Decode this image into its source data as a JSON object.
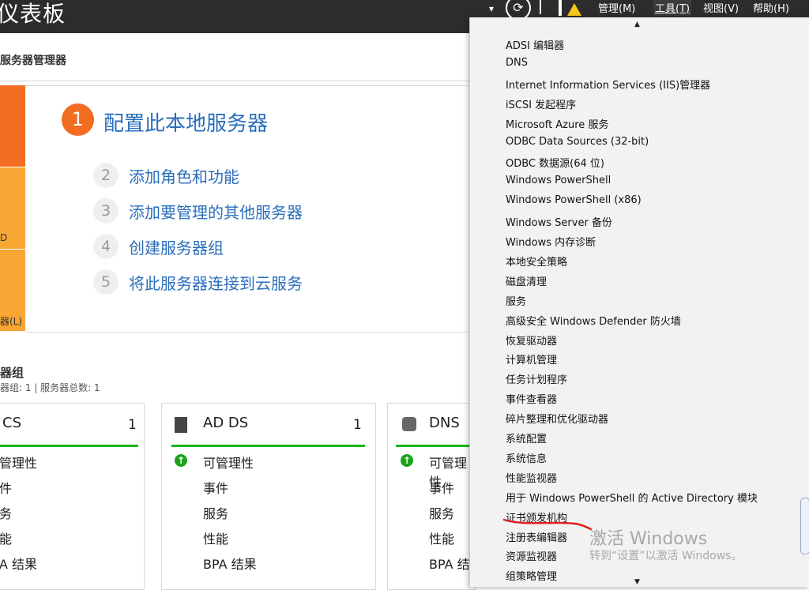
{
  "header": {
    "title": "仪表板",
    "menus": [
      {
        "label": "管理(M)"
      },
      {
        "label": "工具(T)"
      },
      {
        "label": "视图(V)"
      },
      {
        "label": "帮助(H)"
      }
    ],
    "dropdown_glyph": "▾",
    "refresh_glyph": "⟳"
  },
  "welcome": {
    "subtitle": "服务器管理器",
    "sidebar_text_1": "D",
    "sidebar_text_2": "器(L)",
    "main_step": {
      "num": "1",
      "label": "配置此本地服务器"
    },
    "steps": [
      {
        "num": "2",
        "label": "添加角色和功能"
      },
      {
        "num": "3",
        "label": "添加要管理的其他服务器"
      },
      {
        "num": "4",
        "label": "创建服务器组"
      },
      {
        "num": "5",
        "label": "将此服务器连接到云服务"
      }
    ]
  },
  "server_groups": {
    "title": "器组",
    "summary": "器组: 1 | 服务器总数: 1",
    "cards": [
      {
        "name": "CS",
        "count": "1",
        "rows": [
          "管理性",
          "件",
          "务",
          "能",
          "A 结果"
        ]
      },
      {
        "name": "AD DS",
        "count": "1",
        "rows": [
          "可管理性",
          "事件",
          "服务",
          "性能",
          "BPA 结果"
        ]
      },
      {
        "name": "DNS",
        "count": "",
        "rows": [
          "可管理性",
          "事件",
          "服务",
          "性能",
          "BPA 结"
        ]
      }
    ]
  },
  "tools_menu": {
    "up_arrow": "▲",
    "down_arrow": "▼",
    "items": [
      "ADSI 编辑器",
      "DNS",
      "Internet Information Services (IIS)管理器",
      "iSCSI 发起程序",
      "Microsoft Azure 服务",
      "ODBC Data Sources (32-bit)",
      "ODBC 数据源(64 位)",
      "Windows PowerShell",
      "Windows PowerShell (x86)",
      "Windows Server 备份",
      "Windows 内存诊断",
      "本地安全策略",
      "磁盘清理",
      "服务",
      "高级安全 Windows Defender 防火墙",
      "恢复驱动器",
      "计算机管理",
      "任务计划程序",
      "事件查看器",
      "碎片整理和优化驱动器",
      "系统配置",
      "系统信息",
      "性能监视器",
      "用于 Windows PowerShell 的 Active Directory 模块",
      "证书颁发机构",
      "注册表编辑器",
      "资源监视器",
      "组策略管理"
    ]
  },
  "watermark": {
    "line1": "激活 Windows",
    "line2": "转到“设置”以激活 Windows。"
  },
  "colors": {
    "accent_orange": "#f26d21",
    "accent_amber": "#f8a634",
    "link_blue": "#2a6ebb",
    "status_green": "#1cb51c",
    "annotation_red": "#e02020"
  }
}
